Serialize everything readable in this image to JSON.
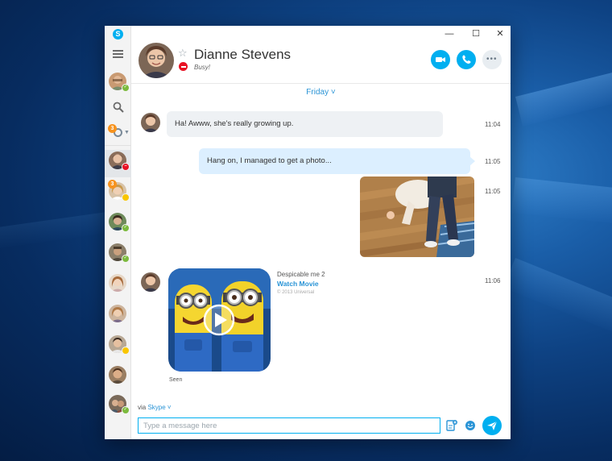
{
  "app": {
    "logo_letter": "S"
  },
  "window_controls": {
    "minimize": "—",
    "maximize": "☐",
    "close": "✕"
  },
  "sidebar": {
    "recent_badge_count": "3",
    "contacts": [
      {
        "status": "busy",
        "active": true
      },
      {
        "status": "away",
        "badge": "3"
      },
      {
        "status": "online"
      },
      {
        "status": "online"
      },
      {
        "status": "none"
      },
      {
        "status": "none"
      },
      {
        "status": "away"
      },
      {
        "status": "none"
      },
      {
        "status": "online"
      }
    ]
  },
  "header": {
    "contact_name": "Dianne Stevens",
    "status_text": "Busy!",
    "status_color": "#e81123"
  },
  "conversation": {
    "day_label": "Friday ˅",
    "messages": [
      {
        "direction": "in",
        "text": "Ha! Awww, she's really growing up.",
        "time": "11:04"
      },
      {
        "direction": "out",
        "text": "Hang on, I managed to get a photo...",
        "time": "11:05"
      },
      {
        "direction": "out",
        "type": "photo",
        "time": "11:05"
      },
      {
        "direction": "in",
        "type": "video",
        "time": "11:06",
        "video_title": "Despicable me 2",
        "video_action": "Watch Movie",
        "video_copyright": "© 2013 Universal",
        "receipt": "Seen"
      }
    ]
  },
  "composer": {
    "via_prefix": "via",
    "via_service": "Skype ˅",
    "placeholder": "Type a message here"
  },
  "colors": {
    "accent": "#00aff0",
    "link": "#2a94d6",
    "online": "#7cba3d",
    "away": "#f9c600",
    "busy": "#e81123",
    "badge": "#f7931e"
  }
}
